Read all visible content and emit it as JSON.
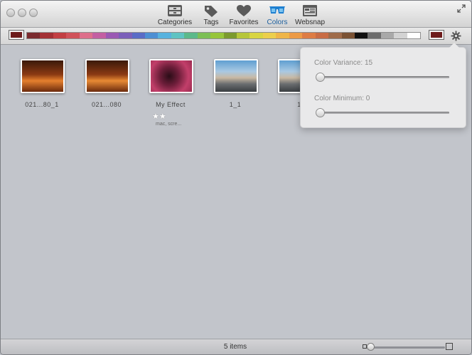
{
  "toolbar": {
    "items": [
      {
        "label": "Categories",
        "icon": "categories-icon"
      },
      {
        "label": "Tags",
        "icon": "tag-icon"
      },
      {
        "label": "Favorites",
        "icon": "heart-icon"
      },
      {
        "label": "Colors",
        "icon": "glasses-icon",
        "active": true
      },
      {
        "label": "Websnap",
        "icon": "websnap-icon"
      }
    ]
  },
  "colorbar": {
    "selected_color": "#6d1b1b",
    "right_selected_color": "#6d1b1b",
    "palette": [
      "#7a2b2e",
      "#a33135",
      "#c23f43",
      "#d0525a",
      "#dd6f8b",
      "#c35fa2",
      "#9a59b3",
      "#7b5fb9",
      "#5a6cc6",
      "#4d8fd3",
      "#57b2de",
      "#5fc3c2",
      "#5cb98a",
      "#7cbf55",
      "#96c53a",
      "#7b9a2e",
      "#b6c63a",
      "#d8d542",
      "#eccf4c",
      "#efb548",
      "#ec9a45",
      "#dd7c44",
      "#c86c45",
      "#9f6b4a",
      "#7a5234",
      "#101010",
      "#6c6c6c",
      "#a9a9a9",
      "#d3d3d3",
      "#ffffff"
    ]
  },
  "items": [
    {
      "name": "021...80_1"
    },
    {
      "name": "021...080"
    },
    {
      "name": "My Effect",
      "stars": "★★",
      "tags": "mac, scre..."
    },
    {
      "name": "1_1"
    },
    {
      "name": "1"
    }
  ],
  "popover": {
    "variance_label": "Color Variance: 15",
    "variance_value": 15,
    "minimum_label": "Color Minimum: 0",
    "minimum_value": 0
  },
  "status": {
    "count_text": "5 items"
  }
}
